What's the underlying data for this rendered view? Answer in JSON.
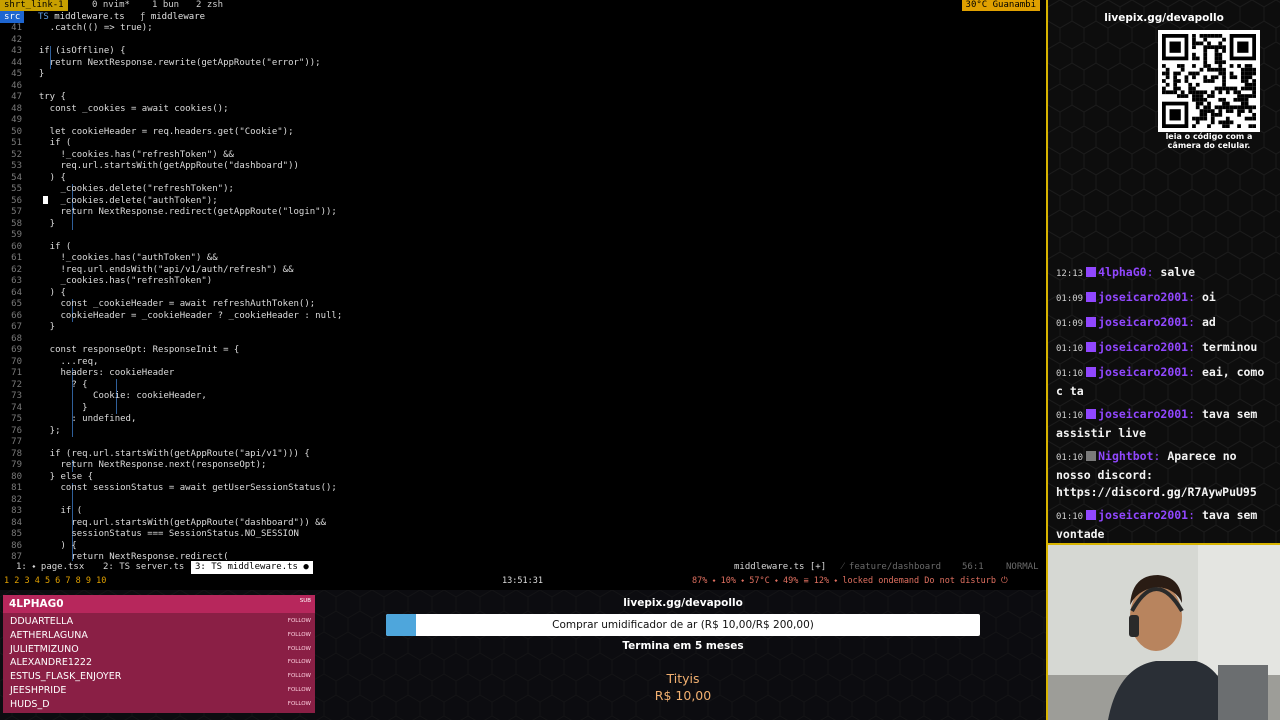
{
  "tmux_top": {
    "session": "shrt_link-1",
    "windows": [
      {
        "label": "0 nvim*"
      },
      {
        "label": "1 bun"
      },
      {
        "label": "2 zsh"
      }
    ],
    "weather": "30°C Guanambi"
  },
  "winbar": {
    "root": "src",
    "file": "middleware.ts",
    "symbol": "middleware"
  },
  "editor": {
    "lines": [
      {
        "n": "41",
        "text": "    .catch(() => true);"
      },
      {
        "n": "42",
        "text": ""
      },
      {
        "n": "43",
        "text": "  if (isOffline) {"
      },
      {
        "n": "44",
        "text": "    return NextResponse.rewrite(getAppRoute(\"error\"));"
      },
      {
        "n": "45",
        "text": "  }"
      },
      {
        "n": "46",
        "text": ""
      },
      {
        "n": "47",
        "text": "  try {"
      },
      {
        "n": "48",
        "text": "    const _cookies = await cookies();"
      },
      {
        "n": "49",
        "text": ""
      },
      {
        "n": "50",
        "text": "    let cookieHeader = req.headers.get(\"Cookie\");"
      },
      {
        "n": "51",
        "text": "    if ("
      },
      {
        "n": "52",
        "text": "      !_cookies.has(\"refreshToken\") &&"
      },
      {
        "n": "53",
        "text": "      req.url.startsWith(getAppRoute(\"dashboard\"))"
      },
      {
        "n": "54",
        "text": "    ) {"
      },
      {
        "n": "55",
        "text": "      _cookies.delete(\"refreshToken\");"
      },
      {
        "n": "56",
        "text": "      _cookies.delete(\"authToken\");"
      },
      {
        "n": "57",
        "text": "      return NextResponse.redirect(getAppRoute(\"login\"));"
      },
      {
        "n": "58",
        "text": "    }"
      },
      {
        "n": "59",
        "text": ""
      },
      {
        "n": "60",
        "text": "    if ("
      },
      {
        "n": "61",
        "text": "      !_cookies.has(\"authToken\") &&"
      },
      {
        "n": "62",
        "text": "      !req.url.endsWith(\"api/v1/auth/refresh\") &&"
      },
      {
        "n": "63",
        "text": "      _cookies.has(\"refreshToken\")"
      },
      {
        "n": "64",
        "text": "    ) {"
      },
      {
        "n": "65",
        "text": "      const _cookieHeader = await refreshAuthToken();"
      },
      {
        "n": "66",
        "text": "      cookieHeader = _cookieHeader ? _cookieHeader : null;"
      },
      {
        "n": "67",
        "text": "    }"
      },
      {
        "n": "68",
        "text": ""
      },
      {
        "n": "69",
        "text": "    const responseOpt: ResponseInit = {"
      },
      {
        "n": "70",
        "text": "      ...req,"
      },
      {
        "n": "71",
        "text": "      headers: cookieHeader"
      },
      {
        "n": "72",
        "text": "        ? {"
      },
      {
        "n": "73",
        "text": "            Cookie: cookieHeader,"
      },
      {
        "n": "74",
        "text": "          }"
      },
      {
        "n": "75",
        "text": "        : undefined,"
      },
      {
        "n": "76",
        "text": "    };"
      },
      {
        "n": "77",
        "text": ""
      },
      {
        "n": "78",
        "text": "    if (req.url.startsWith(getAppRoute(\"api/v1\"))) {"
      },
      {
        "n": "79",
        "text": "      return NextResponse.next(responseOpt);"
      },
      {
        "n": "80",
        "text": "    } else {"
      },
      {
        "n": "81",
        "text": "      const sessionStatus = await getUserSessionStatus();"
      },
      {
        "n": "82",
        "text": ""
      },
      {
        "n": "83",
        "text": "      if ("
      },
      {
        "n": "84",
        "text": "        req.url.startsWith(getAppRoute(\"dashboard\")) &&"
      },
      {
        "n": "85",
        "text": "        sessionStatus === SessionStatus.NO_SESSION"
      },
      {
        "n": "86",
        "text": "      ) {"
      },
      {
        "n": "87",
        "text": "        return NextResponse.redirect("
      }
    ]
  },
  "statusline": {
    "buffers": [
      {
        "label": "1: ⬩ page.tsx"
      },
      {
        "label": "2: TS server.ts"
      },
      {
        "label": "3: TS middleware.ts ●"
      }
    ],
    "file": "middleware.ts [+]",
    "branch": "feature/dashboard",
    "position": "56:1",
    "mode": "NORMAL"
  },
  "tmux_bottom": {
    "workspaces": "1 2 3 4 5 6 7 8 9 10",
    "clock": "13:51:31",
    "stats": "87% ⬩ 10% ⬩ 57°C ⬩ 49% ≡ 12% ⬩ locked  ondemand  Do not disturb  ⏻"
  },
  "right_panel": {
    "livepix_url": "livepix.gg/devapollo",
    "qr_caption_1": "leia o código com a",
    "qr_caption_2": "câmera do celular."
  },
  "chat": [
    {
      "time": "12:13",
      "user": "4lphaG0",
      "text": "salve",
      "badge_color": "#9147ff"
    },
    {
      "time": "01:09",
      "user": "joseicaro2001",
      "text": "oi",
      "badge_color": "#9147ff"
    },
    {
      "time": "01:09",
      "user": "joseicaro2001",
      "text": "ad",
      "badge_color": "#9147ff"
    },
    {
      "time": "01:10",
      "user": "joseicaro2001",
      "text": "terminou",
      "badge_color": "#9147ff"
    },
    {
      "time": "01:10",
      "user": "joseicaro2001",
      "text": "eai, como c ta",
      "badge_color": "#9147ff"
    },
    {
      "time": "01:10",
      "user": "joseicaro2001",
      "text": "tava sem assistir live",
      "badge_color": "#9147ff"
    },
    {
      "time": "01:10",
      "user": "Nightbot",
      "text": "Aparece no nosso discord: https://discord.gg/R7AywPuU95",
      "badge_color": "#7a7a7a"
    },
    {
      "time": "01:10",
      "user": "joseicaro2001",
      "text": "tava sem vontade",
      "badge_color": "#9147ff"
    }
  ],
  "followers": {
    "top": {
      "name": "4LPHAG0",
      "tag": "SUB"
    },
    "list": [
      {
        "name": "DDUARTELLA",
        "tag": "FOLLOW"
      },
      {
        "name": "AETHERLAGUNA",
        "tag": "FOLLOW"
      },
      {
        "name": "JULIETMIZUNO",
        "tag": "FOLLOW"
      },
      {
        "name": "ALEXANDRE1222",
        "tag": "FOLLOW"
      },
      {
        "name": "ESTUS_FLASK_ENJOYER",
        "tag": "FOLLOW"
      },
      {
        "name": "JEESHPRIDE",
        "tag": "FOLLOW"
      },
      {
        "name": "HUDS_D",
        "tag": "FOLLOW"
      }
    ]
  },
  "goal": {
    "url": "livepix.gg/devapollo",
    "text": "Comprar umidificador de ar (R$ 10,00/R$ 200,00)",
    "progress": 0.05,
    "ends": "Termina em 5 meses",
    "donor": "Tityis",
    "donor_amount": "R$ 10,00"
  },
  "colors": {
    "accent_yellow": "#d8b400",
    "twitch_purple": "#9147ff",
    "follower_bg": "#8a1f45",
    "goal_fill": "#4ea6dc",
    "keyword": "#e0504a",
    "string": "#e8e8e8"
  }
}
